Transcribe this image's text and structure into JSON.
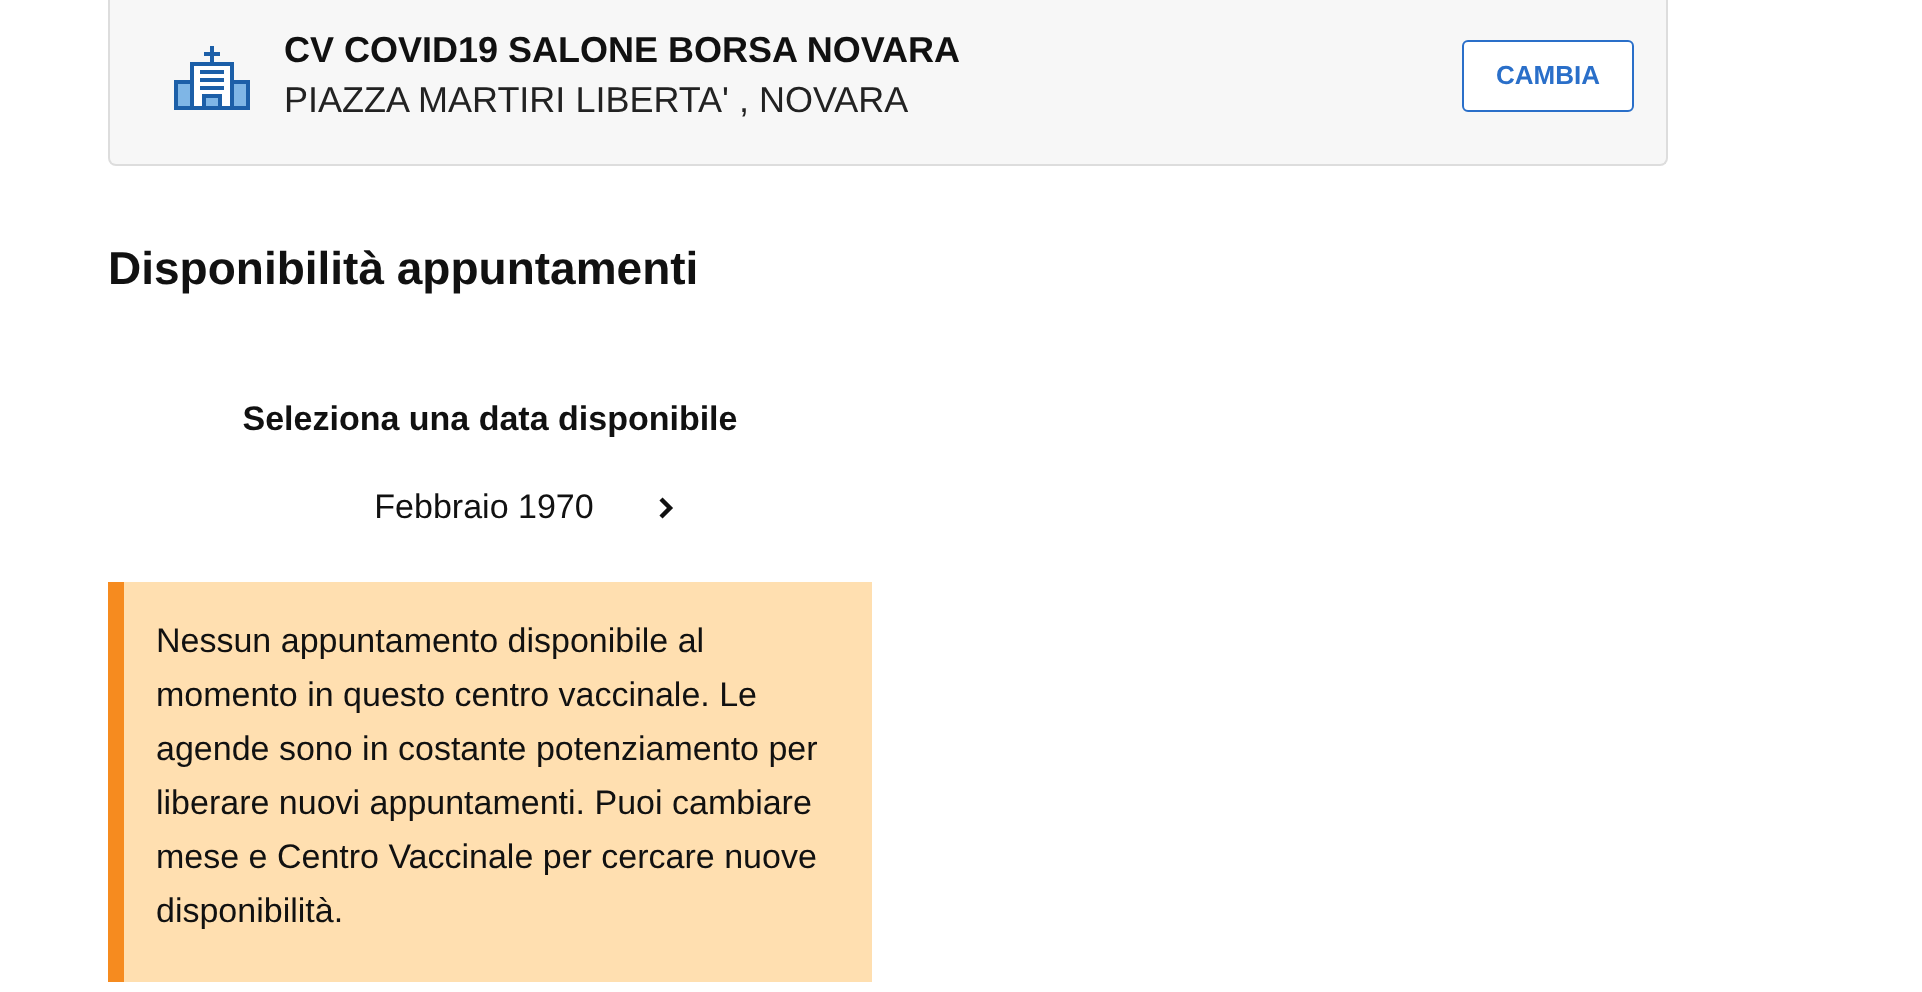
{
  "center": {
    "name": "CV COVID19 SALONE BORSA NOVARA",
    "address": "PIAZZA MARTIRI LIBERTA' , NOVARA",
    "button": "CAMBIA"
  },
  "section_title": "Disponibilità appuntamenti",
  "calendar": {
    "prompt": "Seleziona una data disponibile",
    "month": "Febbraio 1970"
  },
  "alert": "Nessun appuntamento disponibile al momento in questo centro vaccinale. Le agende sono in costante potenziamento per liberare nuovi appuntamenti. Puoi cambiare mese e Centro Vaccinale per cercare nuove disponibilità."
}
